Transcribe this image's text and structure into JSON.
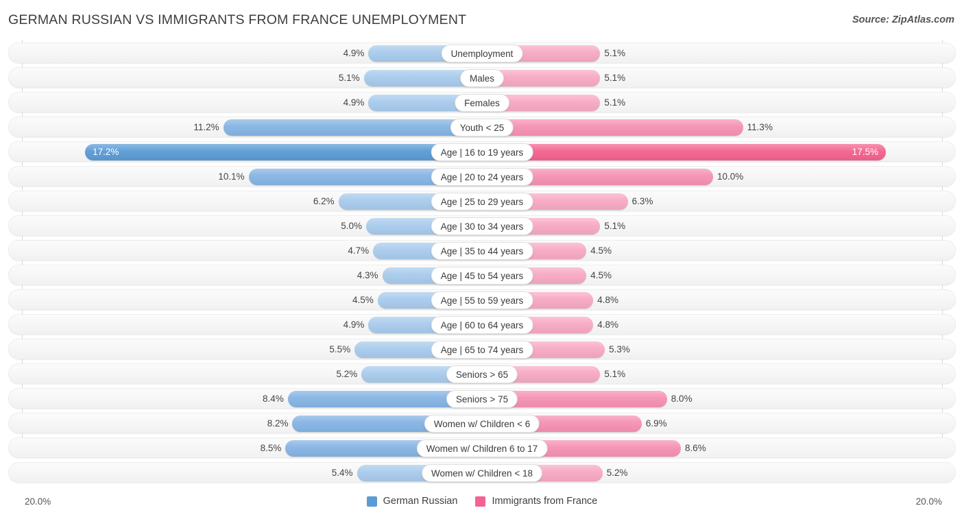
{
  "header": {
    "title": "GERMAN RUSSIAN VS IMMIGRANTS FROM FRANCE UNEMPLOYMENT",
    "source": "Source: ZipAtlas.com"
  },
  "footer": {
    "axis_left": "20.0%",
    "axis_right": "20.0%",
    "legend": [
      {
        "label": "German Russian",
        "color": "#5b9bd5"
      },
      {
        "label": "Immigrants from France",
        "color": "#f4628f"
      }
    ]
  },
  "colors": {
    "left_light": "#a8cbec",
    "left_mid": "#85b4e3",
    "left_strong": "#5b9bd5",
    "right_light": "#f8a9c4",
    "right_mid": "#f691b4",
    "right_strong": "#f4628f",
    "track": "#f6f6f6",
    "gridline": "#d8d8d8"
  },
  "chart_data": {
    "type": "bar",
    "subtype": "diverging-bidirectional",
    "title": "GERMAN RUSSIAN VS IMMIGRANTS FROM FRANCE UNEMPLOYMENT",
    "xlabel": "",
    "ylabel": "",
    "xlim": [
      20.0,
      20.0
    ],
    "axis_max": 20.0,
    "unit": "%",
    "grid": true,
    "legend_position": "bottom-center",
    "categories": [
      "Unemployment",
      "Males",
      "Females",
      "Youth < 25",
      "Age | 16 to 19 years",
      "Age | 20 to 24 years",
      "Age | 25 to 29 years",
      "Age | 30 to 34 years",
      "Age | 35 to 44 years",
      "Age | 45 to 54 years",
      "Age | 55 to 59 years",
      "Age | 60 to 64 years",
      "Age | 65 to 74 years",
      "Seniors > 65",
      "Seniors > 75",
      "Women w/ Children < 6",
      "Women w/ Children 6 to 17",
      "Women w/ Children < 18"
    ],
    "series": [
      {
        "name": "German Russian",
        "color": "#5b9bd5",
        "values": [
          4.9,
          5.1,
          4.9,
          11.2,
          17.2,
          10.1,
          6.2,
          5.0,
          4.7,
          4.3,
          4.5,
          4.9,
          5.5,
          5.2,
          8.4,
          8.2,
          8.5,
          5.4
        ]
      },
      {
        "name": "Immigrants from France",
        "color": "#f4628f",
        "values": [
          5.1,
          5.1,
          5.1,
          11.3,
          17.5,
          10.0,
          6.3,
          5.1,
          4.5,
          4.5,
          4.8,
          4.8,
          5.3,
          5.1,
          8.0,
          6.9,
          8.6,
          5.2
        ]
      }
    ]
  },
  "rows": [
    {
      "label": "Unemployment",
      "left": "4.9%",
      "right": "5.1%",
      "left_val": 4.9,
      "right_val": 5.1,
      "tone": "light"
    },
    {
      "label": "Males",
      "left": "5.1%",
      "right": "5.1%",
      "left_val": 5.1,
      "right_val": 5.1,
      "tone": "light"
    },
    {
      "label": "Females",
      "left": "4.9%",
      "right": "5.1%",
      "left_val": 4.9,
      "right_val": 5.1,
      "tone": "light"
    },
    {
      "label": "Youth < 25",
      "left": "11.2%",
      "right": "11.3%",
      "left_val": 11.2,
      "right_val": 11.3,
      "tone": "mid"
    },
    {
      "label": "Age | 16 to 19 years",
      "left": "17.2%",
      "right": "17.5%",
      "left_val": 17.2,
      "right_val": 17.5,
      "tone": "strong"
    },
    {
      "label": "Age | 20 to 24 years",
      "left": "10.1%",
      "right": "10.0%",
      "left_val": 10.1,
      "right_val": 10.0,
      "tone": "mid"
    },
    {
      "label": "Age | 25 to 29 years",
      "left": "6.2%",
      "right": "6.3%",
      "left_val": 6.2,
      "right_val": 6.3,
      "tone": "light"
    },
    {
      "label": "Age | 30 to 34 years",
      "left": "5.0%",
      "right": "5.1%",
      "left_val": 5.0,
      "right_val": 5.1,
      "tone": "light"
    },
    {
      "label": "Age | 35 to 44 years",
      "left": "4.7%",
      "right": "4.5%",
      "left_val": 4.7,
      "right_val": 4.5,
      "tone": "light"
    },
    {
      "label": "Age | 45 to 54 years",
      "left": "4.3%",
      "right": "4.5%",
      "left_val": 4.3,
      "right_val": 4.5,
      "tone": "light"
    },
    {
      "label": "Age | 55 to 59 years",
      "left": "4.5%",
      "right": "4.8%",
      "left_val": 4.5,
      "right_val": 4.8,
      "tone": "light"
    },
    {
      "label": "Age | 60 to 64 years",
      "left": "4.9%",
      "right": "4.8%",
      "left_val": 4.9,
      "right_val": 4.8,
      "tone": "light"
    },
    {
      "label": "Age | 65 to 74 years",
      "left": "5.5%",
      "right": "5.3%",
      "left_val": 5.5,
      "right_val": 5.3,
      "tone": "light"
    },
    {
      "label": "Seniors > 65",
      "left": "5.2%",
      "right": "5.1%",
      "left_val": 5.2,
      "right_val": 5.1,
      "tone": "light"
    },
    {
      "label": "Seniors > 75",
      "left": "8.4%",
      "right": "8.0%",
      "left_val": 8.4,
      "right_val": 8.0,
      "tone": "mid"
    },
    {
      "label": "Women w/ Children < 6",
      "left": "8.2%",
      "right": "6.9%",
      "left_val": 8.2,
      "right_val": 6.9,
      "tone": "mid"
    },
    {
      "label": "Women w/ Children 6 to 17",
      "left": "8.5%",
      "right": "8.6%",
      "left_val": 8.5,
      "right_val": 8.6,
      "tone": "mid"
    },
    {
      "label": "Women w/ Children < 18",
      "left": "5.4%",
      "right": "5.2%",
      "left_val": 5.4,
      "right_val": 5.2,
      "tone": "light"
    }
  ]
}
